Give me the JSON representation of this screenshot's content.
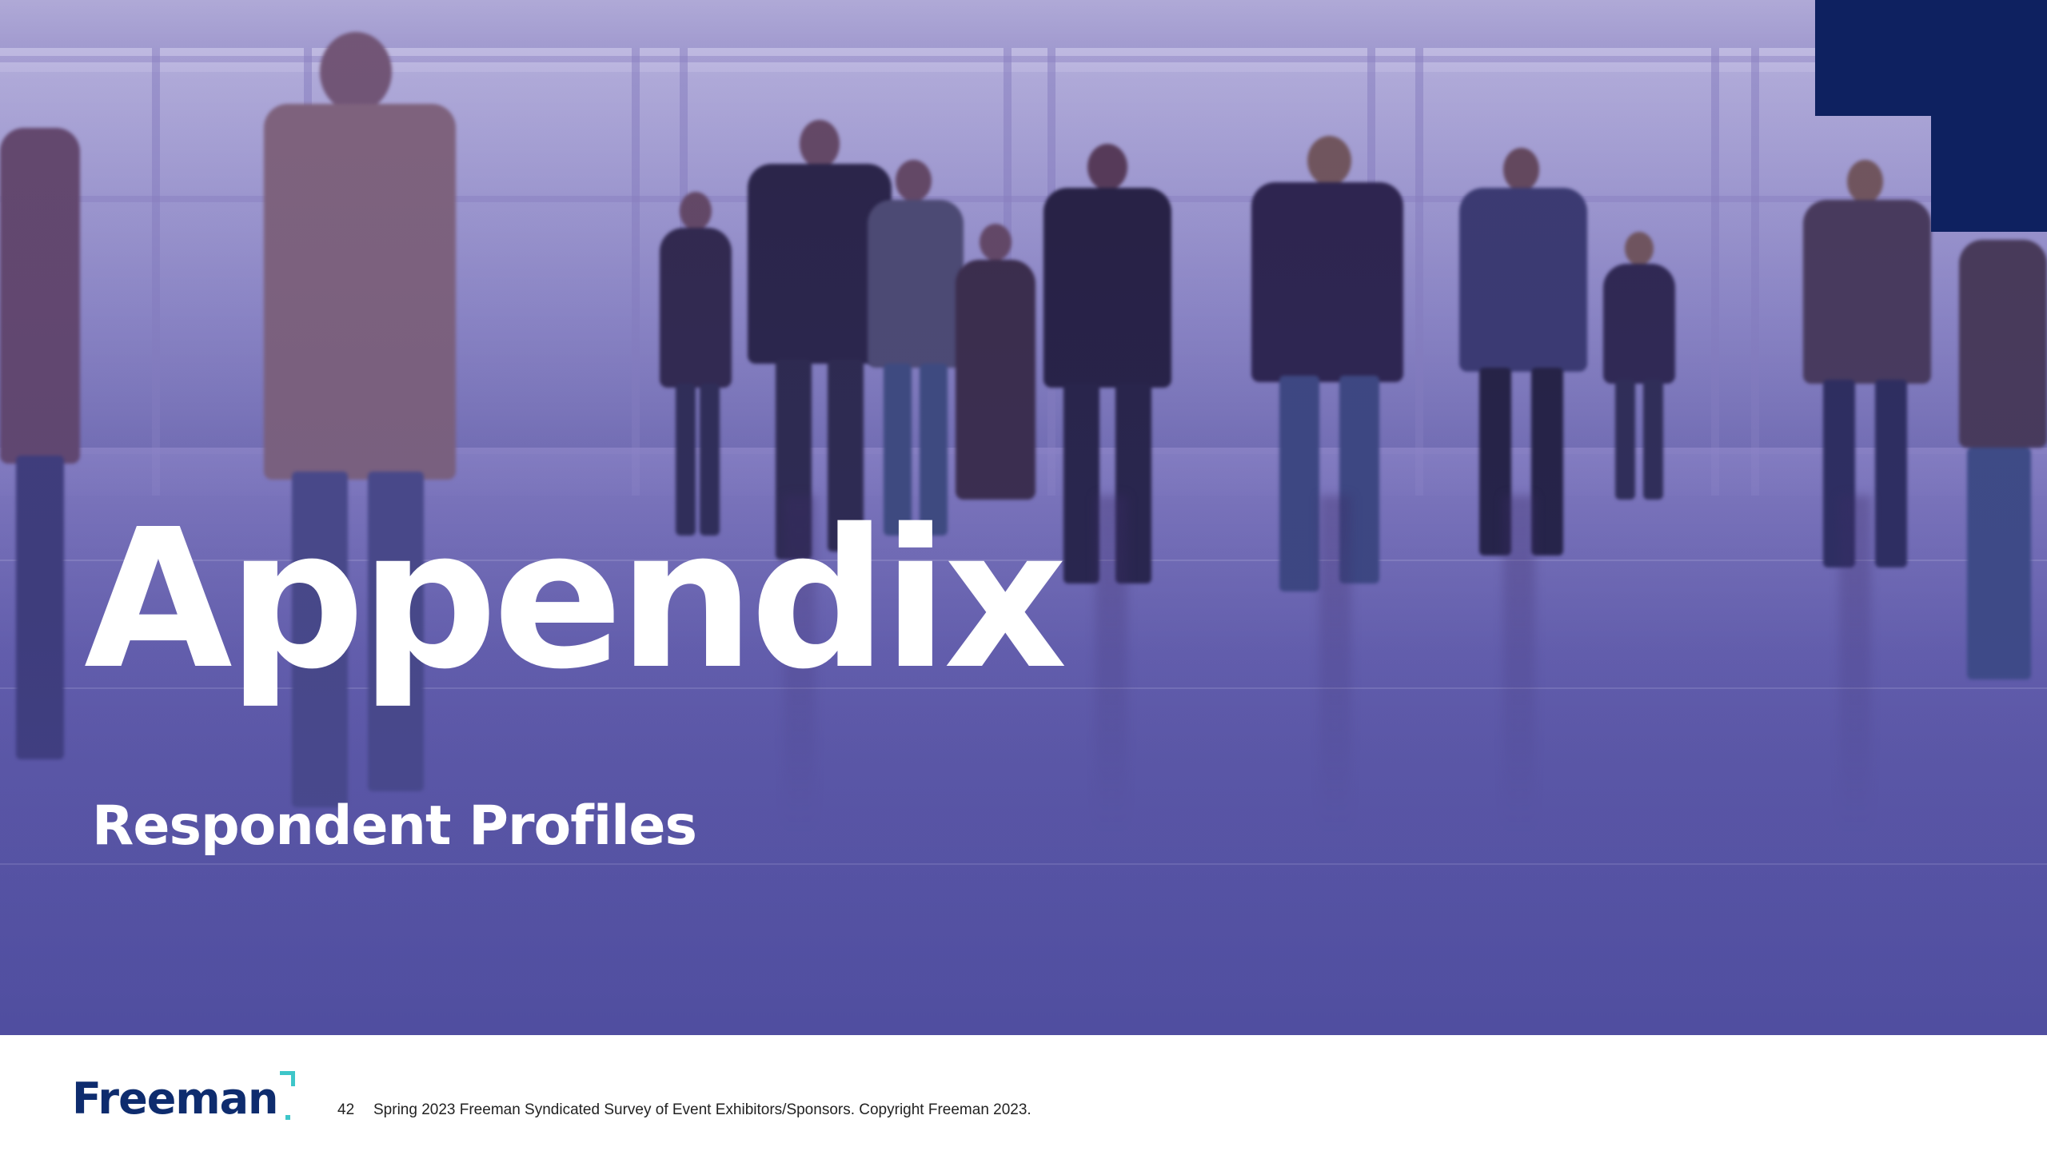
{
  "slide": {
    "title": "Appendix",
    "subtitle": "Respondent Profiles"
  },
  "footer": {
    "logo_text": "Freeman",
    "page_number": "42",
    "caption": "Spring 2023 Freeman Syndicated Survey of Event Exhibitors/Sponsors. Copyright Freeman 2023."
  },
  "colors": {
    "navy": "#0e2160",
    "logo_blue": "#0e2c6e",
    "accent_teal": "#3ec6c9",
    "title_white": "#ffffff",
    "overlay_purple": "#6b64b3"
  }
}
